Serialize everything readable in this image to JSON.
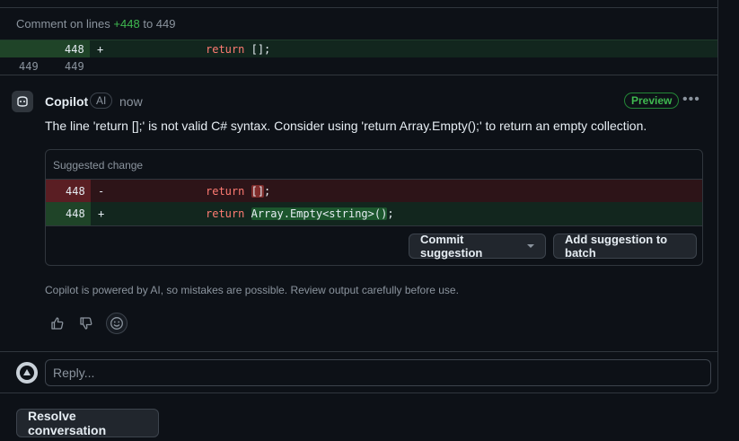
{
  "context": {
    "comment_on_prefix": "Comment on lines",
    "comment_on_added": "+448",
    "comment_on_suffix": "to 449",
    "line_added": {
      "new_num": "448",
      "sign": "+",
      "kw": "return",
      "code": "[];",
      "code_hl": "[]"
    },
    "line_plain": {
      "old_num": "449",
      "new_num": "449"
    }
  },
  "comment": {
    "author": "Copilot",
    "ai_badge": "AI",
    "time": "now",
    "preview_badge": "Preview",
    "more_icon": "kebab-horizontal-icon",
    "body": "The line 'return [];' is not valid C# syntax. Consider using 'return Array.Empty();' to return an empty collection."
  },
  "suggestion": {
    "title": "Suggested change",
    "removed": {
      "num": "448",
      "sign": "-",
      "kw": "return",
      "hl": "[]",
      "rest": ";"
    },
    "added": {
      "num": "448",
      "sign": "+",
      "kw": "return",
      "hl": "Array.Empty<string>()",
      "rest": ";"
    },
    "commit_label": "Commit suggestion",
    "batch_label": "Add suggestion to batch"
  },
  "disclaimer": "Copilot is powered by AI, so mistakes are possible. Review output carefully before use.",
  "reactions": {
    "thumbs_up_icon": "thumbs-up-icon",
    "thumbs_down_icon": "thumbs-down-icon",
    "emoji_icon": "smiley-icon"
  },
  "reply": {
    "placeholder": "Reply..."
  },
  "resolve_label": "Resolve conversation",
  "colors": {
    "background": "#0d1117",
    "border": "#30363d",
    "added_bg": "#12261e",
    "removed_bg": "#2d1418",
    "accent_green": "#3fb950",
    "keyword": "#ff7b72",
    "muted": "#8b949e"
  }
}
